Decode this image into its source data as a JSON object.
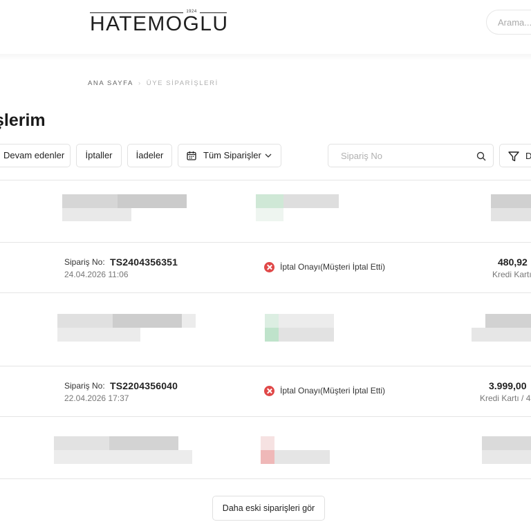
{
  "header": {
    "logo_text": "HATEMOGLU",
    "logo_year": "1924",
    "search_placeholder": "Arama..."
  },
  "breadcrumb": {
    "home": "ANA SAYFA",
    "separator": "›",
    "current": "ÜYE SİPARİŞLERİ"
  },
  "page_title": "şlerim",
  "filters": {
    "ongoing": "Devam edenler",
    "cancels": "İptaller",
    "returns": "İadeler",
    "all_orders": "Tüm Siparişler",
    "order_search_placeholder": "Sipariş No",
    "filter_label": "D"
  },
  "orders": [
    {
      "number_label": "Sipariş No:",
      "number": "TS2404356351",
      "date": "24.04.2026 11:06",
      "status": "İptal Onayı(Müşteri İptal Etti)",
      "status_color": "#e04848",
      "amount": "480,92",
      "payment": "Kredi Kartı"
    },
    {
      "number_label": "Sipariş No:",
      "number": "TS2204356040",
      "date": "22.04.2026 17:37",
      "status": "İptal Onayı(Müşteri İptal Etti)",
      "status_color": "#e04848",
      "amount": "3.999,00",
      "payment": "Kredi Kartı / 4"
    }
  ],
  "more_button": "Daha eski siparişleri gör",
  "colors": {
    "cancel_status": "#e04848",
    "border": "#e2e2e2",
    "text": "#222222"
  }
}
